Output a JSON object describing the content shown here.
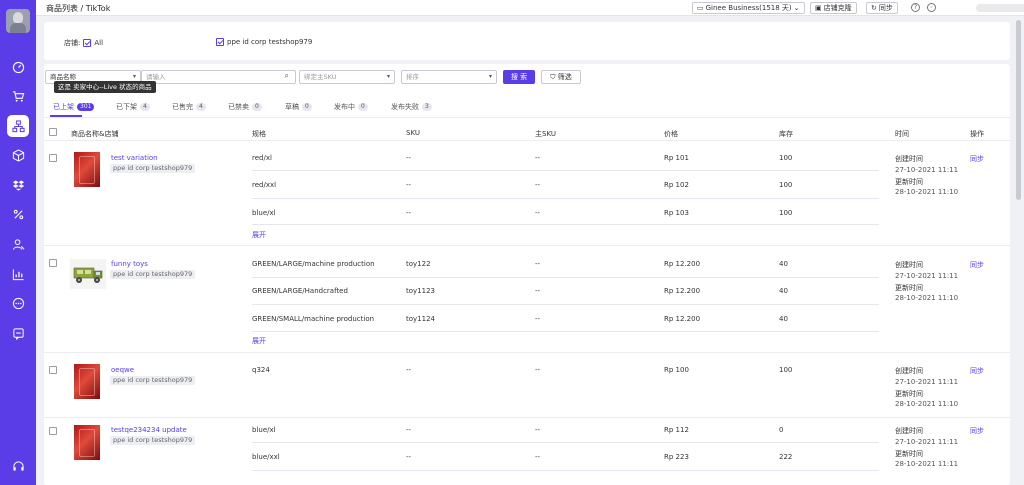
{
  "breadcrumb": "商品列表 / TikTok",
  "topbar": {
    "business": "Ginee Business(1518 天)",
    "store_clone": "店铺克隆",
    "sync": "同步",
    "help_icon": "question-icon",
    "lang_icon": "globe-icon"
  },
  "filter": {
    "store_label": "店铺:",
    "all_label": "All",
    "store_name": "ppe id corp testshop979"
  },
  "search": {
    "field_select": "商品名称",
    "input_placeholder": "请输入",
    "master_sku_placeholder": "绑定主SKU",
    "sort_placeholder": "排序",
    "search_btn": "搜 索",
    "filter_btn": "筛选",
    "tooltip": "这是 卖家中心--Live 状态的商品"
  },
  "tabs": [
    {
      "label": "已上架",
      "count": "301"
    },
    {
      "label": "已下架",
      "count": "4"
    },
    {
      "label": "已售完",
      "count": "4"
    },
    {
      "label": "已禁卖",
      "count": "0"
    },
    {
      "label": "草稿",
      "count": "0"
    },
    {
      "label": "发布中",
      "count": "0"
    },
    {
      "label": "发布失败",
      "count": "3"
    }
  ],
  "columns": [
    "商品名称&店铺",
    "规格",
    "SKU",
    "主SKU",
    "价格",
    "库存",
    "时间",
    "操作"
  ],
  "expand_label": "展开",
  "time_labels": {
    "created": "创建时间",
    "updated": "更新时间"
  },
  "action_label": "同步",
  "products": [
    {
      "name": "test variation",
      "shop": "ppe id corp testshop979",
      "thumb": "red-phone",
      "created": "27-10-2021 11:11",
      "updated": "28-10-2021 11:10",
      "variants": [
        {
          "spec": "red/xl",
          "sku": "--",
          "master_sku": "--",
          "price": "Rp 101",
          "stock": "100"
        },
        {
          "spec": "red/xxl",
          "sku": "--",
          "master_sku": "--",
          "price": "Rp 102",
          "stock": "100"
        },
        {
          "spec": "blue/xl",
          "sku": "--",
          "master_sku": "--",
          "price": "Rp 103",
          "stock": "100"
        }
      ]
    },
    {
      "name": "funny toys",
      "shop": "ppe id corp testshop979",
      "thumb": "toy-truck",
      "created": "27-10-2021 11:11",
      "updated": "28-10-2021 11:10",
      "variants": [
        {
          "spec": "GREEN/LARGE/machine production",
          "sku": "toy122",
          "master_sku": "--",
          "price": "Rp 12.200",
          "stock": "40"
        },
        {
          "spec": "GREEN/LARGE/Handcrafted",
          "sku": "toy1123",
          "master_sku": "--",
          "price": "Rp 12.200",
          "stock": "40"
        },
        {
          "spec": "GREEN/SMALL/machine production",
          "sku": "toy1124",
          "master_sku": "--",
          "price": "Rp 12.200",
          "stock": "40"
        }
      ]
    },
    {
      "name": "oeqwe",
      "shop": "ppe id corp testshop979",
      "thumb": "red-phone",
      "created": "27-10-2021 11:11",
      "updated": "28-10-2021 11:10",
      "variants": [
        {
          "spec": "q324",
          "sku": "--",
          "master_sku": "--",
          "price": "Rp 100",
          "stock": "100"
        }
      ]
    },
    {
      "name": "testqe234234 update",
      "shop": "ppe id corp testshop979",
      "thumb": "red-phone",
      "created": "27-10-2021 11:11",
      "updated": "28-10-2021 11:11",
      "variants": [
        {
          "spec": "blue/xl",
          "sku": "--",
          "master_sku": "--",
          "price": "Rp 112",
          "stock": "0"
        },
        {
          "spec": "blue/xxl",
          "sku": "--",
          "master_sku": "--",
          "price": "Rp 223",
          "stock": "222"
        }
      ]
    }
  ],
  "colors": {
    "accent": "#5b3de8",
    "sidebar": "#5b3de8",
    "background": "#f0f1f5"
  }
}
